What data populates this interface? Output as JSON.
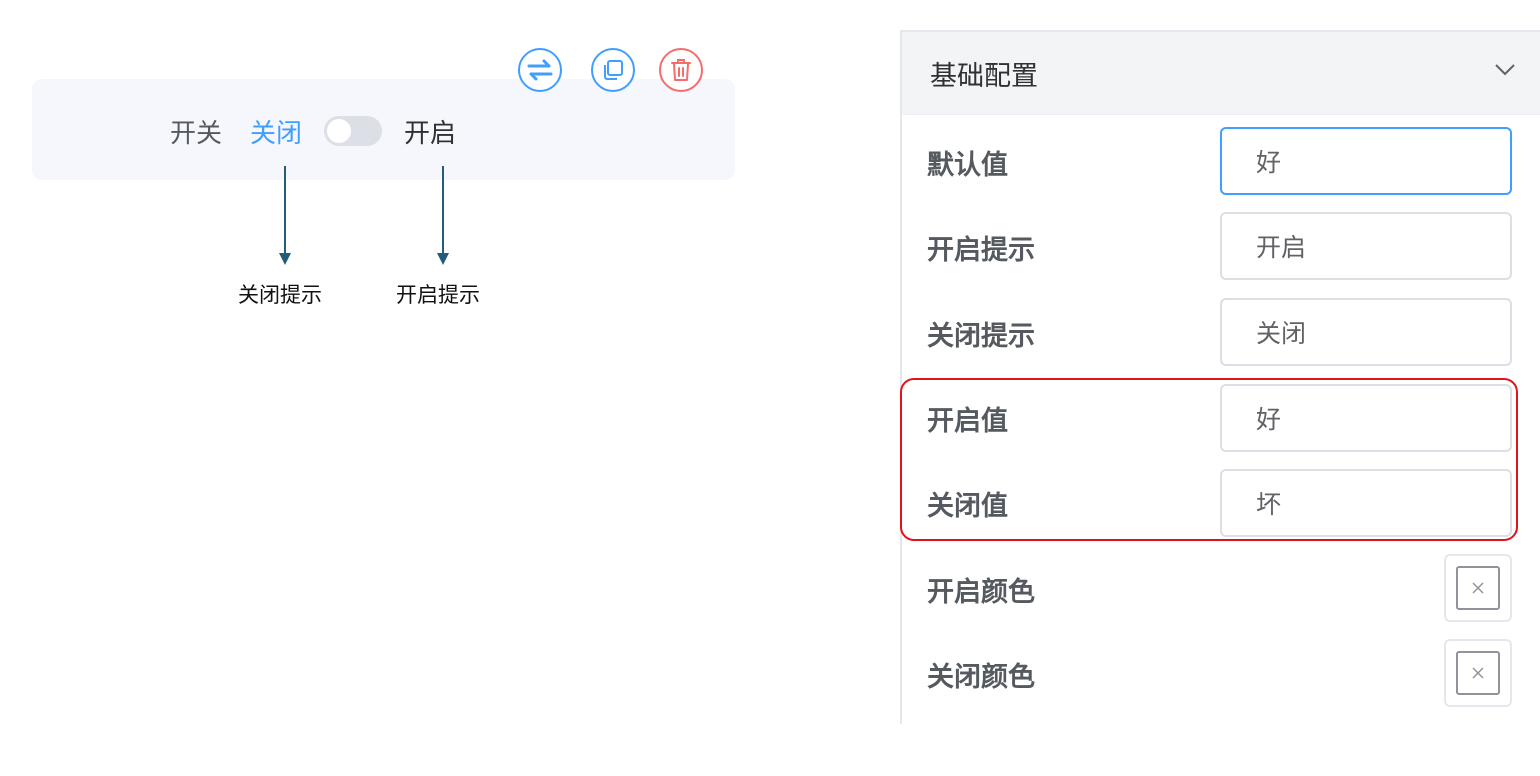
{
  "preview": {
    "switch_label": "开关",
    "off_text": "关闭",
    "on_text": "开启",
    "toggle_state": "off",
    "actions": {
      "swap_icon": "swap-arrows-icon",
      "copy_icon": "copy-icon",
      "delete_icon": "trash-icon"
    },
    "annotations": {
      "off_hint": "关闭提示",
      "on_hint": "开启提示"
    }
  },
  "panel": {
    "title": "基础配置",
    "collapse_icon": "chevron-down-icon",
    "fields": {
      "default_value": {
        "label": "默认值",
        "value": "好"
      },
      "on_hint": {
        "label": "开启提示",
        "value": "开启"
      },
      "off_hint": {
        "label": "关闭提示",
        "value": "关闭"
      },
      "on_value": {
        "label": "开启值",
        "value": "好"
      },
      "off_value": {
        "label": "关闭值",
        "value": "坏"
      },
      "on_color": {
        "label": "开启颜色",
        "icon": "clear-x-icon"
      },
      "off_color": {
        "label": "关闭颜色",
        "icon": "clear-x-icon"
      }
    }
  },
  "colors": {
    "accent": "#409eff",
    "danger": "#f56c6c",
    "annotation_arrow": "#245d7c",
    "highlight": "#e0131b"
  }
}
